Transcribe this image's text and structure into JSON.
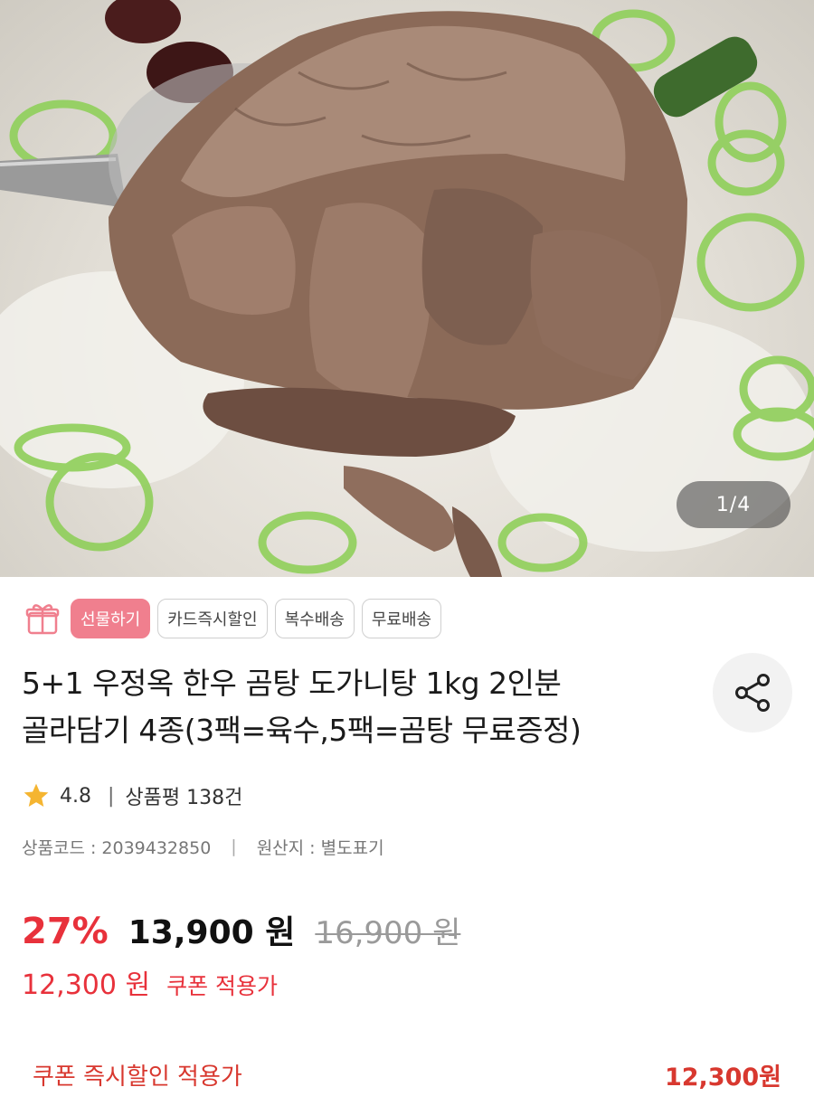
{
  "product_image": {
    "counter": "1/4"
  },
  "tags": [
    {
      "label": "선물하기"
    },
    {
      "label": "카드즉시할인"
    },
    {
      "label": "복수배송"
    },
    {
      "label": "무료배송"
    }
  ],
  "product": {
    "title_line1": "5+1 우정옥 한우 곰탕 도가니탕 1kg 2인분",
    "title_line2": "골라담기 4종(3팩=육수,5팩=곰탕 무료증정)"
  },
  "rating": {
    "score": "4.8",
    "separator": "|",
    "reviews": "상품평 138건"
  },
  "meta": {
    "code": "상품코드 : 2039432850",
    "separator": "|",
    "origin": "원산지 : 별도표기"
  },
  "price": {
    "discount": "27%",
    "current": "13,900 원",
    "original": "16,900 원"
  },
  "coupon": {
    "price": "12,300 원",
    "label": "쿠폰 적용가"
  },
  "footer": {
    "label": "쿠폰 즉시할인 적용가",
    "price": "12,300원"
  },
  "colors": {
    "accent_red": "#e8313b",
    "gift_pink": "#f07f8e",
    "star": "#f5b531"
  },
  "icons": {
    "gift": "gift-icon",
    "share": "share-icon",
    "star": "star-icon"
  }
}
